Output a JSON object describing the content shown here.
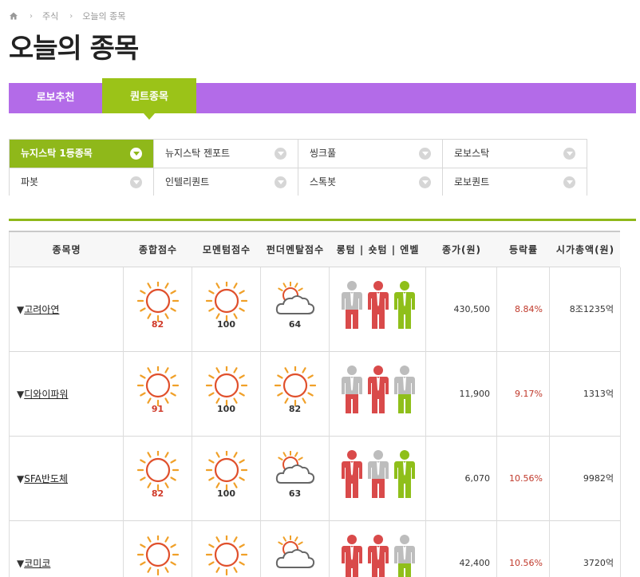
{
  "breadcrumb": {
    "items": [
      "주식",
      "오늘의 종목"
    ]
  },
  "page_title": "오늘의 종목",
  "tabs": [
    {
      "label": "로보추천",
      "active": false
    },
    {
      "label": "퀀트종목",
      "active": true
    }
  ],
  "subtabs": [
    {
      "label": "뉴지스탁 1등종목",
      "active": true
    },
    {
      "label": "뉴지스탁 젠포트"
    },
    {
      "label": "씽크풀"
    },
    {
      "label": "로보스탁"
    },
    {
      "label": "파봇"
    },
    {
      "label": "인텔리퀀트"
    },
    {
      "label": "스톡봇"
    },
    {
      "label": "로보퀀트"
    }
  ],
  "table": {
    "headers": [
      "종목명",
      "종합점수",
      "모멘텀점수",
      "펀더멘탈점수",
      "롱텀 | 숏텀 | 엔벨",
      "종가(원)",
      "등락률",
      "시가총액(원)"
    ],
    "rows": [
      {
        "name": "고려아연",
        "total": {
          "icon": "sun-icon",
          "score": "82"
        },
        "momentum": {
          "icon": "sun-icon",
          "score": "100"
        },
        "fundamental": {
          "icon": "cloud-icon",
          "score": "64"
        },
        "signals": [
          "gray-red",
          "red",
          "green"
        ],
        "price": "430,500",
        "change": "8.84%",
        "cap": "8조1235억"
      },
      {
        "name": "디와이파워",
        "total": {
          "icon": "sun-icon",
          "score": "91"
        },
        "momentum": {
          "icon": "sun-icon",
          "score": "100"
        },
        "fundamental": {
          "icon": "sun-icon",
          "score": "82"
        },
        "signals": [
          "gray-red",
          "red",
          "gray-green"
        ],
        "price": "11,900",
        "change": "9.17%",
        "cap": "1313억"
      },
      {
        "name": "SFA반도체",
        "total": {
          "icon": "sun-icon",
          "score": "82"
        },
        "momentum": {
          "icon": "sun-icon",
          "score": "100"
        },
        "fundamental": {
          "icon": "cloud-icon",
          "score": "63"
        },
        "signals": [
          "red",
          "gray-red",
          "green"
        ],
        "price": "6,070",
        "change": "10.56%",
        "cap": "9982억"
      },
      {
        "name": "코미코",
        "total": {
          "icon": "sun-icon",
          "score": ""
        },
        "momentum": {
          "icon": "sun-icon",
          "score": ""
        },
        "fundamental": {
          "icon": "cloud-icon",
          "score": ""
        },
        "signals": [
          "red",
          "red",
          "gray-green"
        ],
        "price": "42,400",
        "change": "10.56%",
        "cap": "3720억"
      }
    ]
  },
  "colors": {
    "purple": "#b36be8",
    "green": "#9bc318",
    "red": "#d94a4a",
    "gray": "#bdbdbd",
    "leaf": "#8fbf1a",
    "sun_ring": "#e0502c",
    "sun_ray": "#f0a028",
    "score_red": "#d03a2a"
  }
}
